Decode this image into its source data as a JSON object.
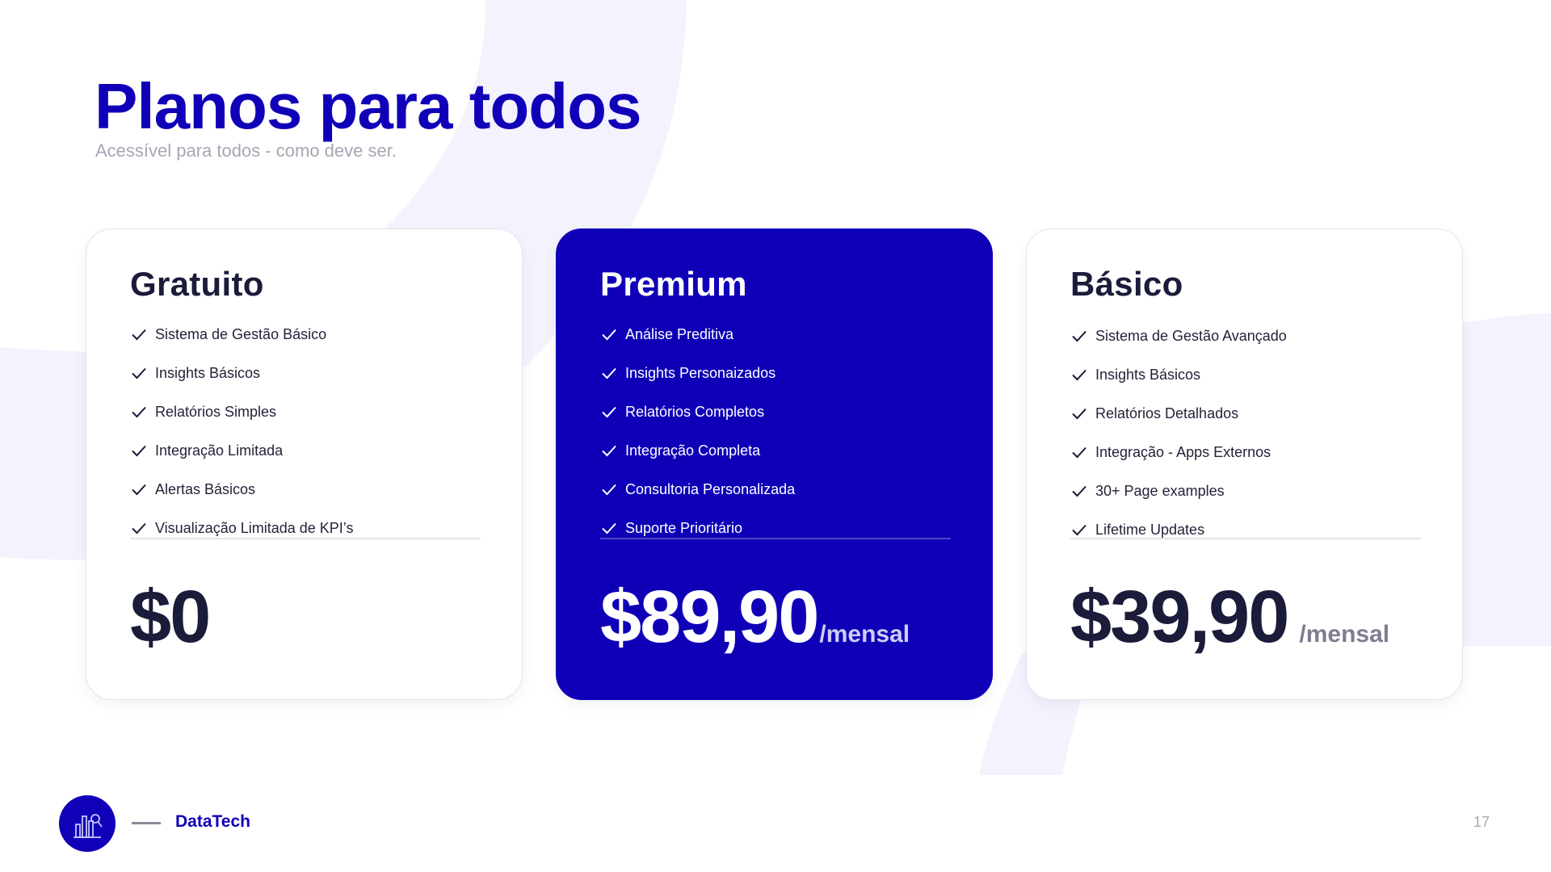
{
  "header": {
    "title": "Planos para todos",
    "subtitle": "Acessível para todos - como deve ser."
  },
  "plans": [
    {
      "name": "Gratuito",
      "features": [
        "Sistema de Gestão Básico",
        "Insights Básicos",
        "Relatórios Simples",
        "Integração Limitada",
        "Alertas Básicos",
        "Visualização Limitada de KPI’s"
      ],
      "price": "$0",
      "period": ""
    },
    {
      "name": "Premium",
      "features": [
        "Análise Preditiva",
        "Insights Personaizados",
        "Relatórios Completos",
        "Integração Completa",
        "Consultoria Personalizada",
        "Suporte Prioritário"
      ],
      "price": "$89,90",
      "period": "/mensal"
    },
    {
      "name": "Básico",
      "features": [
        "Sistema de Gestão Avançado",
        "Insights Básicos",
        "Relatórios Detalhados",
        "Integração - Apps Externos",
        "30+ Page examples",
        "Lifetime Updates"
      ],
      "price": "$39,90",
      "period": "/mensal"
    }
  ],
  "footer": {
    "brand": "DataTech",
    "page_number": "17"
  },
  "colors": {
    "accent": "#1000b8",
    "background_shape": "#f3f2fd",
    "text_dark": "#1b1b3a",
    "muted": "#a6a6b4"
  },
  "icons": {
    "feature": "check-icon",
    "logo": "datatech-logo-icon"
  }
}
